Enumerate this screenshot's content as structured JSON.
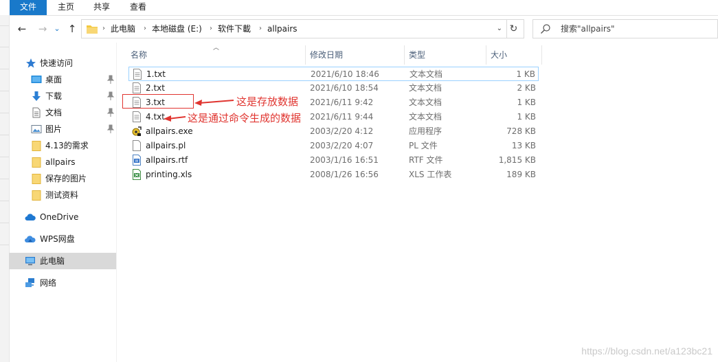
{
  "ribbon": {
    "tabs": [
      "文件",
      "主页",
      "共享",
      "查看"
    ]
  },
  "nav": {
    "back": "←",
    "forward": "→",
    "recent": "⌄",
    "up": "↑",
    "breadcrumbs": [
      "此电脑",
      "本地磁盘 (E:)",
      "软件下載",
      "allpairs"
    ],
    "refresh": "↻",
    "search_placeholder": "搜索\"allpairs\""
  },
  "sidebar": {
    "quick_access": "快速访问",
    "items": [
      {
        "label": "桌面",
        "icon": "desktop-icon",
        "pinned": true
      },
      {
        "label": "下载",
        "icon": "download-icon",
        "pinned": true
      },
      {
        "label": "文档",
        "icon": "document-icon",
        "pinned": true
      },
      {
        "label": "图片",
        "icon": "picture-icon",
        "pinned": true
      },
      {
        "label": "4.13的需求",
        "icon": "folder-icon",
        "pinned": false
      },
      {
        "label": "allpairs",
        "icon": "folder-icon",
        "pinned": false
      },
      {
        "label": "保存的图片",
        "icon": "folder-icon",
        "pinned": false
      },
      {
        "label": "测试资料",
        "icon": "folder-icon",
        "pinned": false
      }
    ],
    "onedrive": "OneDrive",
    "wps": "WPS网盘",
    "this_pc": "此电脑",
    "network": "网络"
  },
  "columns": {
    "name": "名称",
    "date": "修改日期",
    "type": "类型",
    "size": "大小"
  },
  "files": [
    {
      "name": "1.txt",
      "date": "2021/6/10 18:46",
      "type": "文本文档",
      "size": "1 KB",
      "icon": "text-file-icon"
    },
    {
      "name": "2.txt",
      "date": "2021/6/10 18:54",
      "type": "文本文档",
      "size": "2 KB",
      "icon": "text-file-icon"
    },
    {
      "name": "3.txt",
      "date": "2021/6/11 9:42",
      "type": "文本文档",
      "size": "1 KB",
      "icon": "text-file-icon"
    },
    {
      "name": "4.txt",
      "date": "2021/6/11 9:44",
      "type": "文本文档",
      "size": "1 KB",
      "icon": "text-file-icon"
    },
    {
      "name": "allpairs.exe",
      "date": "2003/2/20 4:12",
      "type": "应用程序",
      "size": "728 KB",
      "icon": "exe-file-icon"
    },
    {
      "name": "allpairs.pl",
      "date": "2003/2/20 4:07",
      "type": "PL 文件",
      "size": "13 KB",
      "icon": "blank-file-icon"
    },
    {
      "name": "allpairs.rtf",
      "date": "2003/1/16 16:51",
      "type": "RTF 文件",
      "size": "1,815 KB",
      "icon": "rtf-file-icon"
    },
    {
      "name": "printing.xls",
      "date": "2008/1/26 16:56",
      "type": "XLS 工作表",
      "size": "189 KB",
      "icon": "xls-file-icon"
    }
  ],
  "annotations": {
    "storage": "这是存放数据",
    "generated": "这是通过命令生成的数据",
    "color": "#e0342f"
  },
  "watermark": "https://blog.csdn.net/a123bc21",
  "colors": {
    "accent": "#1979ca",
    "selection_border": "#99d1ff",
    "sidebar_selected": "#d9d9d9"
  }
}
